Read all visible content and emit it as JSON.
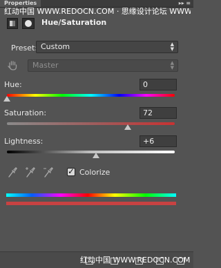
{
  "panel": {
    "tab": "Properties",
    "menu_glyph": "▸▸ ≡"
  },
  "watermark_top": "红动中国 WWW.REDOCN.COM · 思缘设计论坛 WWW.MISSYUAN.COM",
  "header": {
    "title": "Hue/Saturation"
  },
  "preset": {
    "label": "Preset:",
    "value": "Custom"
  },
  "channel": {
    "value": "Master"
  },
  "hue": {
    "label": "Hue:",
    "value": "0",
    "fraction": 0.0
  },
  "saturation": {
    "label": "Saturation:",
    "value": "72",
    "fraction": 0.72
  },
  "lightness": {
    "label": "Lightness:",
    "value": "+6",
    "fraction": 0.53
  },
  "colorize": {
    "label": "Colorize",
    "checked": true
  },
  "select_arrows": "▲\n▼",
  "icons": {
    "adjustment": "hue-saturation-adjustment-icon",
    "mask": "layer-mask-icon",
    "hand": "on-image-adjust-hand-icon",
    "eyedroppers": [
      "eyedropper-icon",
      "eyedropper-plus-icon",
      "eyedropper-minus-icon"
    ]
  },
  "colors": {
    "accent_red": "#c84242",
    "saturation_track_end": "#c83232"
  },
  "watermark_bottom": "红动中国 WWW.REDOCN.COM"
}
